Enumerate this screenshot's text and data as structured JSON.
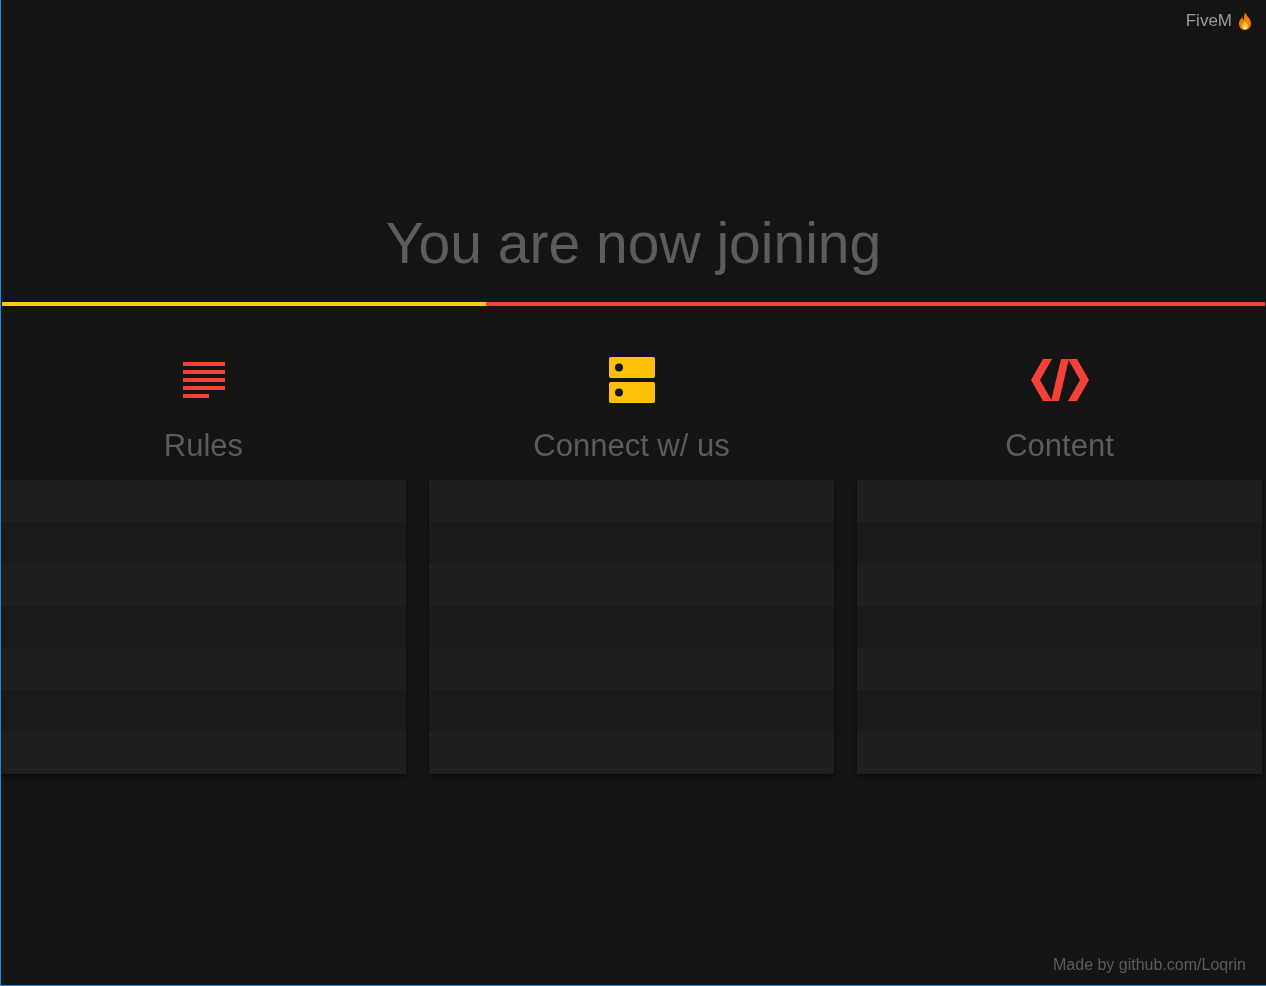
{
  "brand": {
    "label": "FiveM"
  },
  "heading": "You are now joining",
  "progress": {
    "level": 0.383
  },
  "sections": [
    {
      "kind": "list",
      "title": "Rules"
    },
    {
      "kind": "server",
      "title": "Connect w/ us"
    },
    {
      "kind": "code",
      "title": "Content"
    }
  ],
  "footer": "Made by github.com/Loqrin"
}
